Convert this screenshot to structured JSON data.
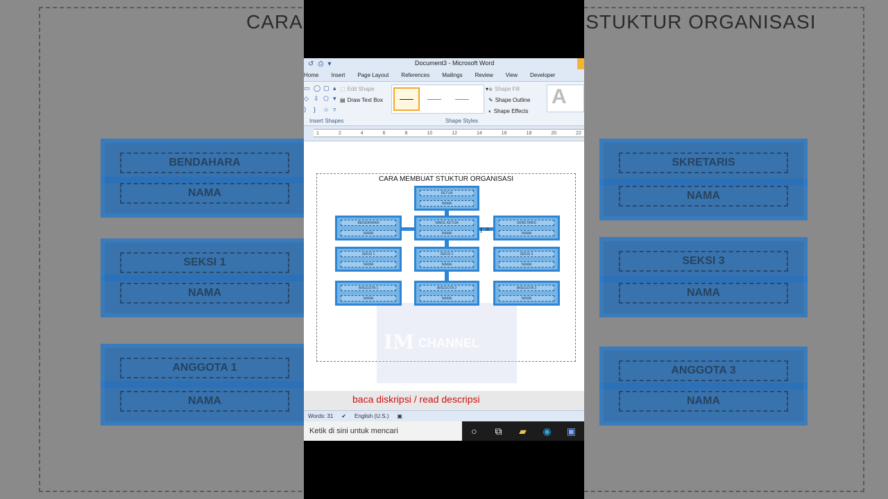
{
  "background": {
    "title": "CARA MEMBUAT STUKTUR ORGANISASI",
    "left_boxes": [
      {
        "top": "BENDAHARA",
        "bottom": "NAMA"
      },
      {
        "top": "SEKSI 1",
        "bottom": "NAMA"
      },
      {
        "top": "ANGGOTA 1",
        "bottom": "NAMA"
      }
    ],
    "right_boxes": [
      {
        "top": "SKRETARIS",
        "bottom": "NAMA"
      },
      {
        "top": "SEKSI 3",
        "bottom": "NAMA"
      },
      {
        "top": "ANGGOTA 3",
        "bottom": "NAMA"
      }
    ]
  },
  "window": {
    "title": "Document3 - Microsoft Word",
    "tabs": [
      "Home",
      "Insert",
      "Page Layout",
      "References",
      "Mailings",
      "Review",
      "View",
      "Developer"
    ]
  },
  "ribbon": {
    "edit_shape": "Edit Shape",
    "draw_text_box": "Draw Text Box",
    "insert_shapes_label": "Insert Shapes",
    "shape_styles_label": "Shape Styles",
    "shape_fill": "Shape Fill",
    "shape_outline": "Shape Outline",
    "shape_effects": "Shape Effects",
    "wordart_letter": "A"
  },
  "ruler": {
    "ticks": [
      "1",
      "2",
      "4",
      "6",
      "8",
      "10",
      "12",
      "14",
      "16",
      "18",
      "20",
      "22"
    ]
  },
  "document": {
    "heading": "CARA MEMBUAT STUKTUR ORGANISASI",
    "boxes": {
      "ketua": {
        "top": "KETUA",
        "bottom": "NAMA"
      },
      "bendahara": {
        "top": "BENDAHARA",
        "bottom": "NAMA"
      },
      "wakil": {
        "top": "WAKIL KETUA",
        "bottom": "NAMA"
      },
      "skretaris": {
        "top": "SKRETARIS",
        "bottom": "NAMA"
      },
      "seksi1": {
        "top": "SEKSI 1",
        "bottom": "NAMA"
      },
      "seksi2": {
        "top": "SEKSI 2",
        "bottom": "NAMA"
      },
      "seksi3": {
        "top": "SEKSI 3",
        "bottom": "NAMA"
      },
      "anggota1": {
        "top": "ANGGOTA 1",
        "bottom": "NAMA"
      },
      "anggota2": {
        "top": "ANGGOTA 2",
        "bottom": "NAMA"
      },
      "anggota3": {
        "top": "ANGGOTA 3",
        "bottom": "NAMA"
      }
    },
    "watermark_big": "IM",
    "watermark_small": "CHANNEL"
  },
  "caption": "baca diskripsi / read descripsi",
  "status": {
    "words": "Words: 31",
    "language": "English (U.S.)"
  },
  "taskbar": {
    "search_placeholder": "Ketik di sini untuk mencari"
  },
  "colors": {
    "box_fill": "#74b4e6",
    "box_border": "#2d85d4",
    "caption": "#cc1111"
  }
}
